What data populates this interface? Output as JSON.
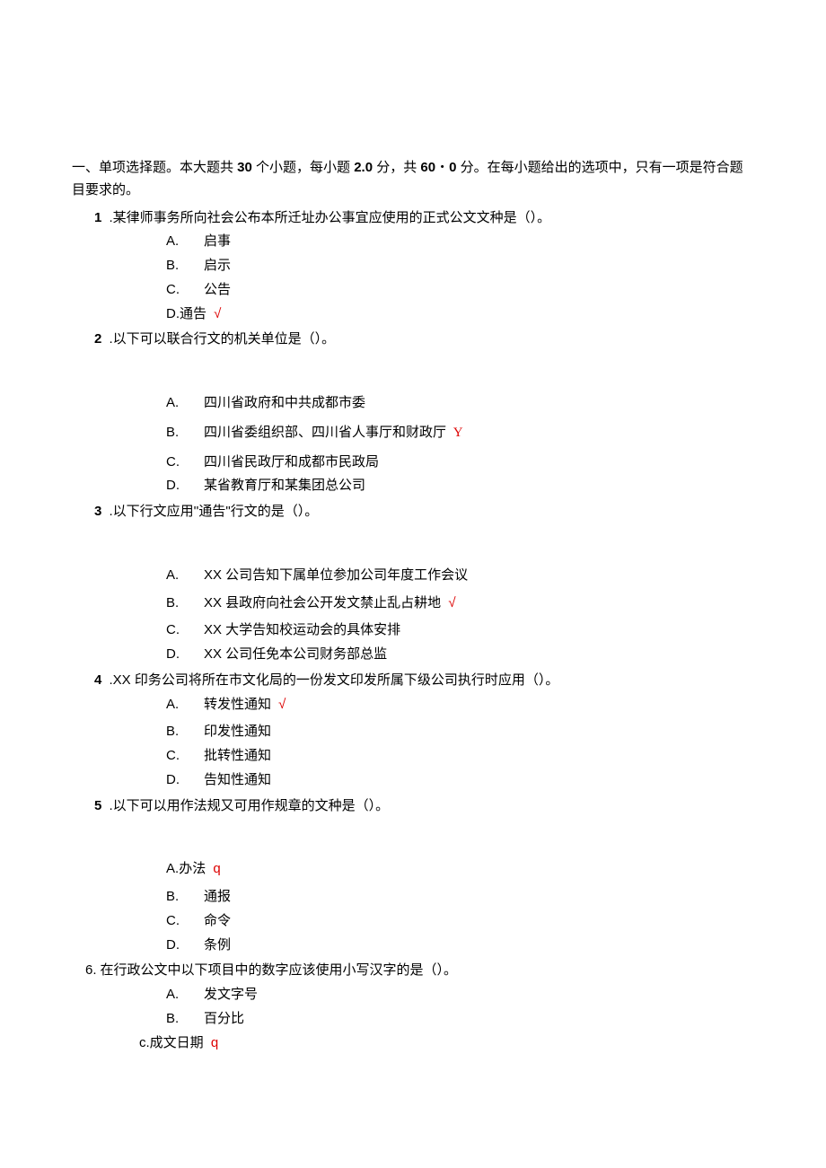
{
  "intro": {
    "part1": "一、单项选择题。本大题共 ",
    "n1": "30",
    "part2": " 个小题，每小题 ",
    "s1": "2.0",
    "part3": " 分，共 ",
    "s2": "60",
    "dot": "・",
    "s3": "0",
    "part4": " 分。在每小题给出的选项中，只有一项是符合题目要求的。"
  },
  "q1": {
    "num": "1",
    "stem": " .某律师事务所向社会公布本所迁址办公事宜应使用的正式公文文种是（）。",
    "A": "启事",
    "B": "启示",
    "C": "公告",
    "Dlabel": "D.",
    "D": "通告",
    "mark": " √"
  },
  "q2": {
    "num": "2",
    "stem": " .以下可以联合行文的机关单位是（）。",
    "A": "四川省政府和中共成都市委",
    "B": "四川省委组织部、四川省人事厅和财政厅",
    "Bmark": " Y",
    "C": "四川省民政厅和成都市民政局",
    "D": "某省教育厅和某集团总公司"
  },
  "q3": {
    "num": "3",
    "stem": " .以下行文应用''通告\"行文的是（）。",
    "A": "XX 公司告知下属单位参加公司年度工作会议",
    "B": "XX 县政府向社会公开发文禁止乱占耕地",
    "Bmark": " √",
    "C": "XX 大学告知校运动会的具体安排",
    "D": "XX 公司任免本公司财务部总监"
  },
  "q4": {
    "num": "4",
    "stem": " .XX 印务公司将所在市文化局的一份发文印发所属下级公司执行时应用（）。",
    "A": "转发性通知",
    "Amark": " √",
    "B": "印发性通知",
    "C": "批转性通知",
    "D": "告知性通知"
  },
  "q5": {
    "num": "5",
    "stem": " .以下可以用作法规又可用作规章的文种是（）。",
    "Alabel": "A.",
    "A": "办法",
    "Amark": " q",
    "B": "通报",
    "C": "命令",
    "D": "条例"
  },
  "q6": {
    "num": "6.",
    "stem": "在行政公文中以下项目中的数字应该使用小写汉字的是（）。",
    "A": "发文字号",
    "B": "百分比",
    "Clabel": "c.",
    "C": "成文日期",
    "Cmark": " q"
  },
  "labels": {
    "A": "A.",
    "B": "B.",
    "C": "C.",
    "D": "D."
  }
}
